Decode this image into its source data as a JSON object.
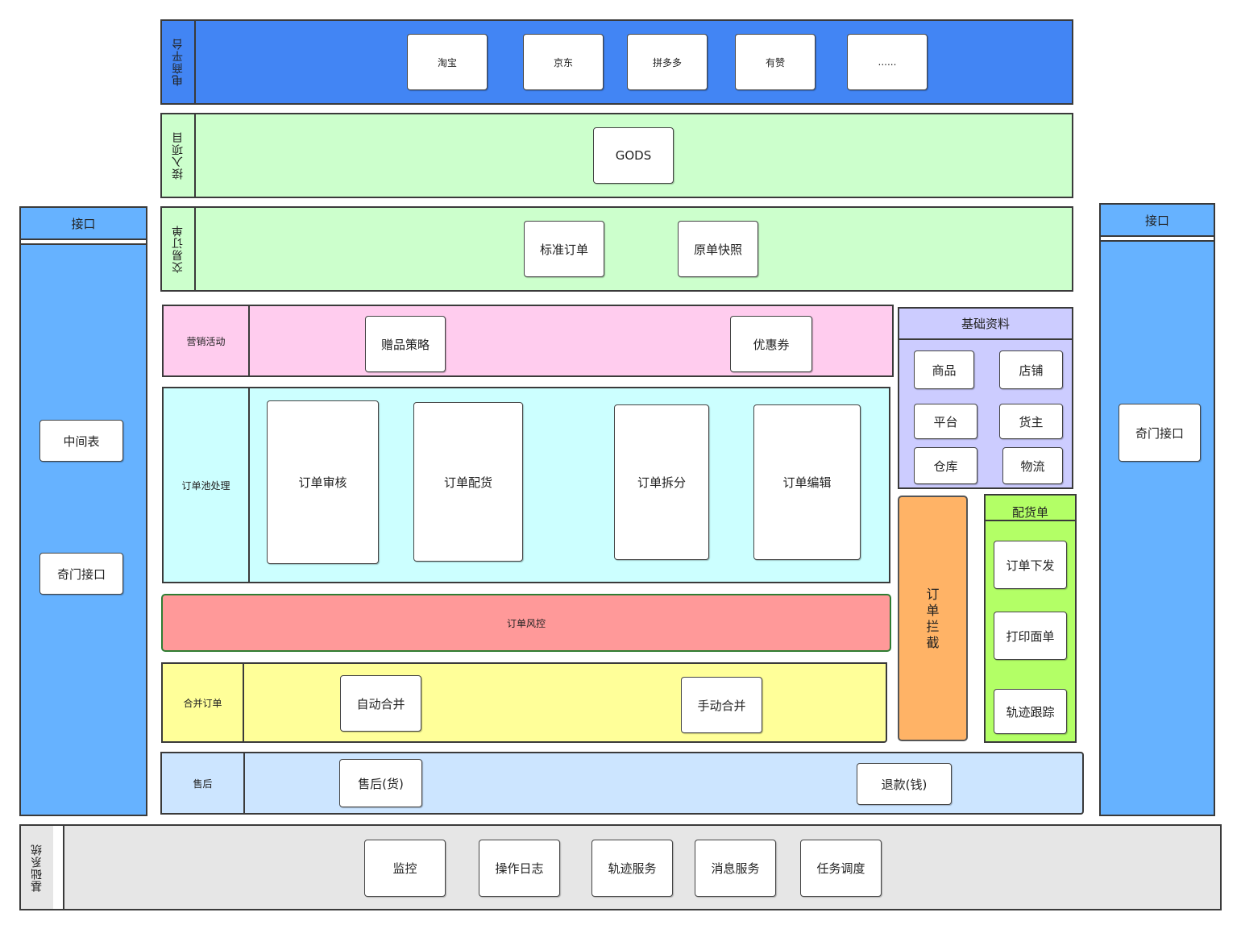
{
  "ecommerce": {
    "label": "电商平台",
    "items": [
      "淘宝",
      "京东",
      "拼多多",
      "有赞",
      "......"
    ]
  },
  "access": {
    "label": "接入项目",
    "items": [
      "GODS"
    ]
  },
  "trade": {
    "label": "交易订单",
    "items": [
      "标准订单",
      "原单快照"
    ]
  },
  "marketing": {
    "label": "营销活动",
    "items": [
      "赠品策略",
      "优惠券"
    ]
  },
  "pool": {
    "label": "订单池处理",
    "items": [
      "订单审核",
      "订单配货",
      "订单拆分",
      "订单编辑"
    ]
  },
  "risk": {
    "label": "订单风控"
  },
  "merge": {
    "label": "合并订单",
    "items": [
      "自动合并",
      "手动合并"
    ]
  },
  "aftersale": {
    "label": "售后",
    "items": [
      "售后(货)",
      "退款(钱)"
    ]
  },
  "base_info": {
    "title": "基础资料",
    "items": [
      "商品",
      "店铺",
      "平台",
      "货主",
      "仓库",
      "物流"
    ]
  },
  "intercept": {
    "label": "订单拦截"
  },
  "picking": {
    "title": "配货单",
    "items": [
      "订单下发",
      "打印面单",
      "轨迹跟踪"
    ]
  },
  "left_interface": {
    "title": "接口",
    "items": [
      "中间表",
      "奇门接口"
    ]
  },
  "right_interface": {
    "title": "接口",
    "items": [
      "奇门接口"
    ]
  },
  "base_system": {
    "label": "基础系统",
    "items": [
      "监控",
      "操作日志",
      "轨迹服务",
      "消息服务",
      "任务调度"
    ]
  },
  "colors": {
    "ecommerce_bg": "#4285f4",
    "green_bg": "#ccffcc",
    "pink_bg": "#ffccee",
    "cyan_bg": "#ccffff",
    "red_bg": "#ff9999",
    "yellow_bg": "#ffff99",
    "lightblue_bg": "#cce5ff",
    "lavender_bg": "#ccccff",
    "orange_bg": "#ffb366",
    "lime_bg": "#b3ff66",
    "side_blue": "#66b2ff",
    "gray_bg": "#e6e6e6"
  }
}
